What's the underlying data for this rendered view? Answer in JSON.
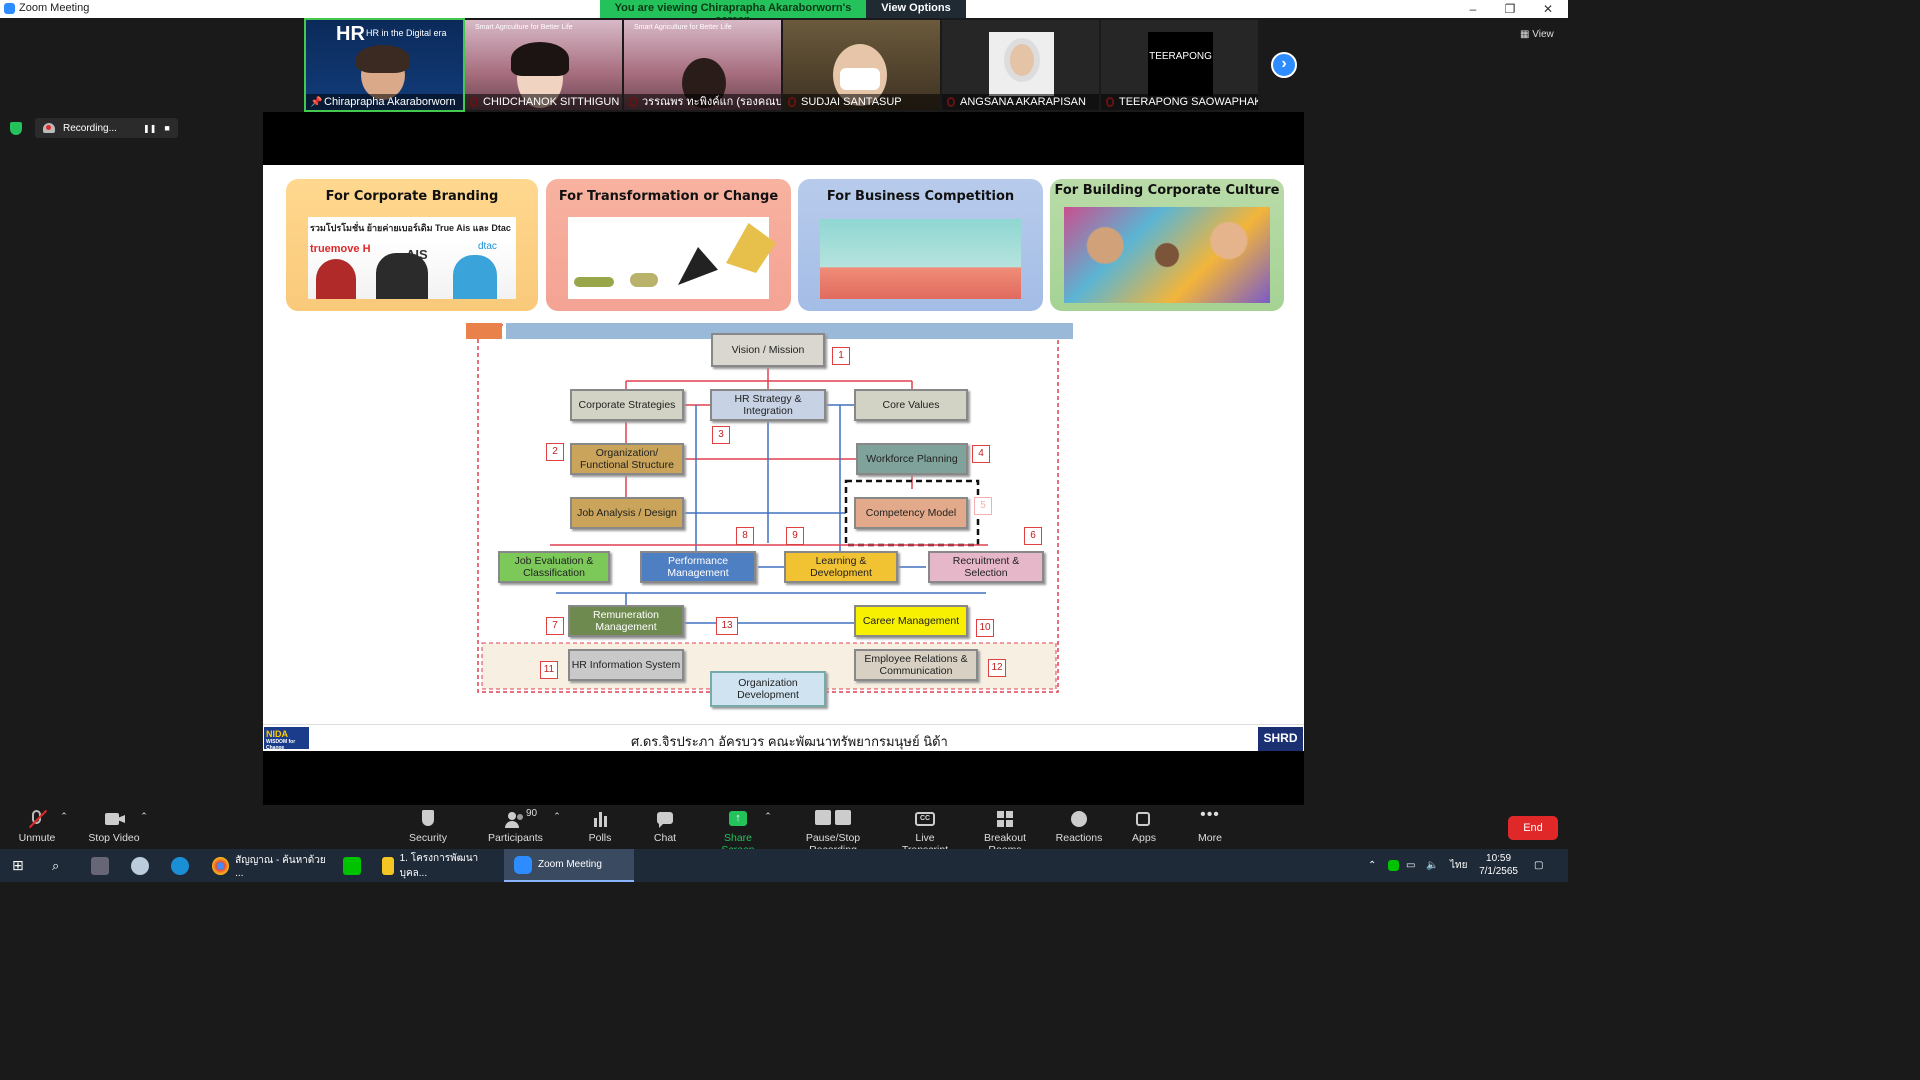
{
  "window": {
    "title": "Zoom Meeting",
    "minimize": "–",
    "restore": "❐",
    "close": "✕"
  },
  "share_banner": {
    "message": "You are viewing Chiraprapha Akaraborworn's screen",
    "view_options": "View Options"
  },
  "participants": [
    {
      "name": "Chiraprapha Akaraborworn",
      "muted": false,
      "overlay": "HR in the Digital era"
    },
    {
      "name": "CHIDCHANOK SITTHIGUN",
      "muted": true,
      "overlay": "Smart Agriculture for Better Life"
    },
    {
      "name": "วรรณพร ทะพิงค์แก (รองคณบดี...",
      "muted": true,
      "overlay": "Smart Agriculture for Better Life"
    },
    {
      "name": "SUDJAI SANTASUP",
      "muted": true,
      "overlay": ""
    },
    {
      "name": "ANGSANA AKARAPISAN",
      "muted": true,
      "overlay": ""
    },
    {
      "name": "TEERAPONG SAOWAPHAK",
      "muted": true,
      "overlay": "TEERAPONG"
    }
  ],
  "view_label": "View",
  "recording": {
    "label": "Recording...",
    "pause": "❚❚",
    "stop": "■"
  },
  "slide": {
    "cards": [
      {
        "title": "For Corporate Branding",
        "caption": "รวมโปรโมชั่น ย้ายค่ายเบอร์เดิม True Ais และ Dtac",
        "brands": [
          "truemove H",
          "AIS",
          "dtac"
        ]
      },
      {
        "title": "For Transformation or Change"
      },
      {
        "title": "For Business Competition"
      },
      {
        "title": "For Building Corporate Culture"
      }
    ],
    "diagram": {
      "vision": "Vision / Mission",
      "corporate": "Corporate Strategies",
      "hrstrategy": "HR Strategy & Integration",
      "core": "Core Values",
      "org": "Organization/ Functional Structure",
      "workforce": "Workforce Planning",
      "jobanalysis": "Job Analysis / Design",
      "competency": "Competency Model",
      "jobeval": "Job Evaluation & Classification",
      "performance": "Performance Management",
      "learning": "Learning & Development",
      "recruitment": "Recruitment & Selection",
      "remuneration": "Remuneration Management",
      "career": "Career Management",
      "hris": "HR Information System",
      "employee": "Employee Relations & Communication",
      "orgdev": "Organization Development",
      "numbers": [
        "1",
        "2",
        "3",
        "4",
        "5",
        "6",
        "7",
        "8",
        "9",
        "10",
        "11",
        "12",
        "13"
      ]
    },
    "footer": "ศ.ดร.จิรประภา อัครบวร คณะพัฒนาทรัพยากรมนุษย์ นิด้า",
    "logo_left": "NIDA",
    "logo_left_sub": "WISDOM for Change",
    "logo_right": "SHRD"
  },
  "toolbar": {
    "unmute": "Unmute",
    "stop_video": "Stop Video",
    "security": "Security",
    "participants": "Participants",
    "participants_count": "90",
    "polls": "Polls",
    "chat": "Chat",
    "share_screen": "Share Screen",
    "pause_stop": "Pause/Stop Recording",
    "live_transcript": "Live Transcript",
    "breakout": "Breakout Rooms",
    "reactions": "Reactions",
    "apps": "Apps",
    "more": "More",
    "end": "End",
    "cc": "CC"
  },
  "taskbar": {
    "apps": [
      {
        "label": "สัญญาณ - ค้นหาด้วย ..."
      },
      {
        "label": "1. โครงการพัฒนาบุคล..."
      },
      {
        "label": "Zoom Meeting"
      }
    ],
    "time": "10:59",
    "date": "7/1/2565",
    "lang": "ไทย"
  }
}
